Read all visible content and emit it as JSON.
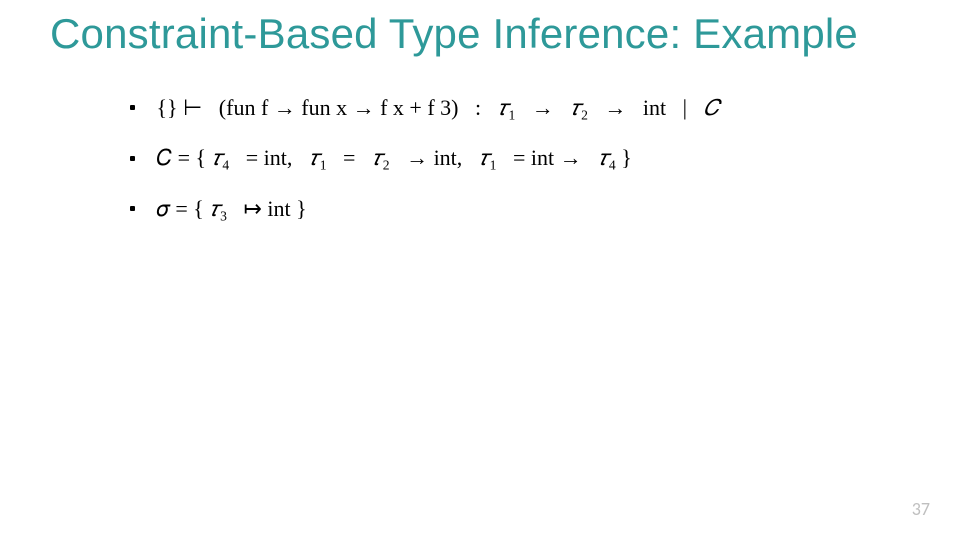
{
  "slide": {
    "title": "Constraint-Based Type Inference: Example",
    "page_number": "37",
    "accent_color": "#2e9999",
    "bullets": [
      {
        "judgment": {
          "env": "{}",
          "turnstile": "⊢",
          "expr_open": "(fun f → fun x → f x + f 3)",
          "colon": ":",
          "type_tau1": "𝜏",
          "type_tau1_sub": "1",
          "arrow1": "→",
          "type_tau2": "𝜏",
          "type_tau2_sub": "2",
          "arrow2": "→",
          "type_int": "int",
          "bar": "|",
          "set_C": "𝐶"
        }
      },
      {
        "constraints": {
          "lhs": "𝐶 = {",
          "c1_l": "𝜏",
          "c1_l_sub": "4",
          "c1_eq": "= int,",
          "c2_l": "𝜏",
          "c2_l_sub": "1",
          "c2_eq": "=",
          "c2_r1": "𝜏",
          "c2_r1_sub": "2",
          "c2_r_arrow": "→ int,",
          "c3_l": "𝜏",
          "c3_l_sub": "1",
          "c3_eq": "= int →",
          "c3_r": "𝜏",
          "c3_r_sub": "4",
          "rhs": "}"
        }
      },
      {
        "subst": {
          "lhs": "𝜎 = {",
          "t": "𝜏",
          "t_sub": "3",
          "maps": "↦ int",
          "rhs": "}"
        }
      }
    ]
  }
}
